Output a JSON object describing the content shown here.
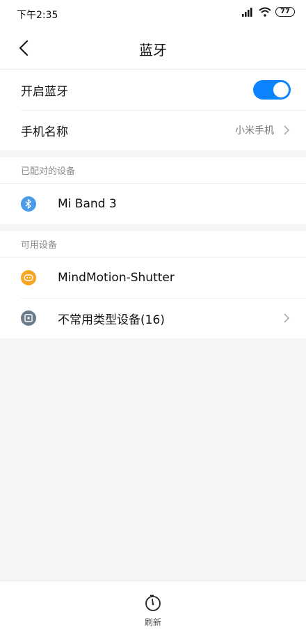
{
  "status_bar": {
    "time": "下午2:35",
    "battery": "77"
  },
  "title_bar": {
    "title": "蓝牙"
  },
  "settings": {
    "enable_label": "开启蓝牙",
    "enable_on": true,
    "device_name_label": "手机名称",
    "device_name_value": "小米手机"
  },
  "paired": {
    "header": "已配对的设备",
    "devices": [
      {
        "label": "Mi Band 3",
        "icon": "bluetooth-icon",
        "icon_color": "#4a9be8"
      }
    ]
  },
  "available": {
    "header": "可用设备",
    "devices": [
      {
        "label": "MindMotion-Shutter",
        "icon": "gamepad-icon",
        "icon_color": "#f5a623"
      },
      {
        "label": "不常用类型设备(16)",
        "icon": "device-icon",
        "icon_color": "#6b7c8a"
      }
    ]
  },
  "bottom": {
    "refresh_label": "刷新"
  },
  "colors": {
    "accent": "#0d84ff"
  }
}
